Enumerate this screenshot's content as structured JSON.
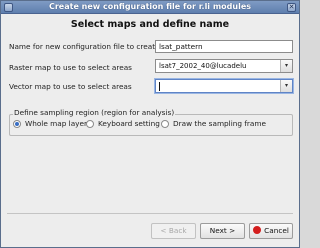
{
  "window": {
    "title": "Create new configuration file for r.li modules"
  },
  "heading": "Select maps and define name",
  "form": {
    "config_name": {
      "label": "Name for new configuration file to create",
      "value": "lsat_pattern"
    },
    "raster_map": {
      "label": "Raster map to use to select areas",
      "value": "lsat7_2002_40@lucadelu"
    },
    "vector_map": {
      "label": "Vector map to use to select areas",
      "value": ""
    }
  },
  "sampling": {
    "title": "Define sampling region (region for analysis)",
    "options": [
      {
        "label": "Whole map layer",
        "selected": true
      },
      {
        "label": "Keyboard setting",
        "selected": false
      },
      {
        "label": "Draw the sampling frame",
        "selected": false
      }
    ]
  },
  "buttons": {
    "back": "< Back",
    "next": "Next >",
    "cancel": "Cancel"
  }
}
